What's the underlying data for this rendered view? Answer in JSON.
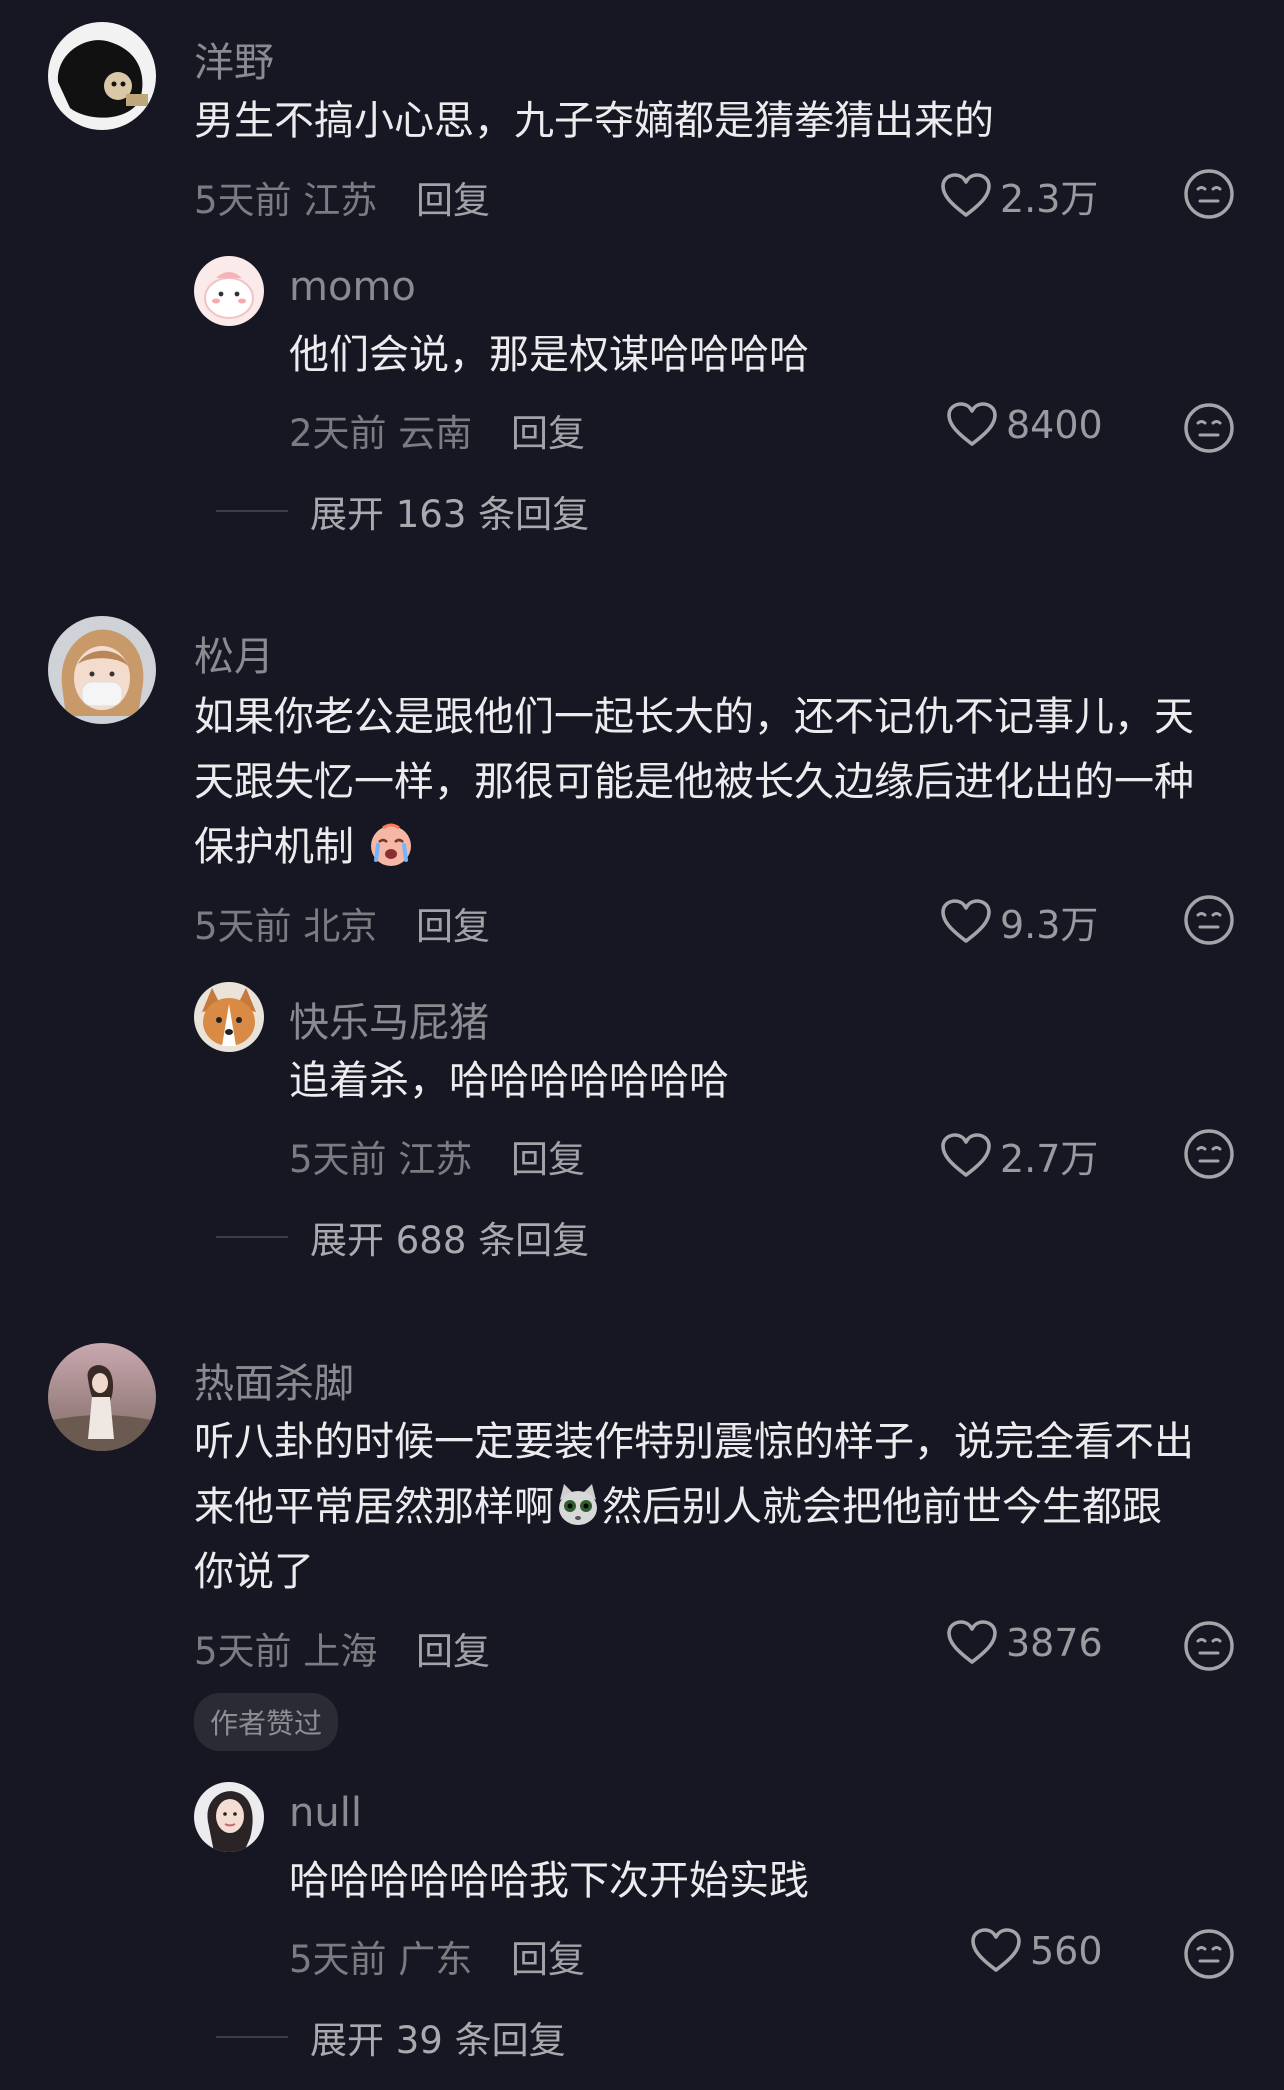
{
  "comments": [
    {
      "username": "洋野",
      "text": "男生不搞小心思，九子夺嫡都是猜拳猜出来的",
      "meta": "5天前 江苏",
      "reply_label": "回复",
      "likes": "2.3万",
      "reply": {
        "username": "momo",
        "text": "他们会说，那是权谋哈哈哈哈",
        "meta": "2天前 云南",
        "reply_label": "回复",
        "likes": "8400"
      },
      "expand_label": "展开 163 条回复"
    },
    {
      "username": "松月",
      "text_line1": "如果你老公是跟他们一起长大的，还不记仇不记事儿，天",
      "text_line2": "天跟失忆一样，那很可能是他被长久边缘后进化出的一种",
      "text_line3": "保护机制",
      "emoji_icon": "crying-face-emoji-icon",
      "meta": "5天前 北京",
      "reply_label": "回复",
      "likes": "9.3万",
      "reply": {
        "username": "快乐马屁猪",
        "text": "追着杀，哈哈哈哈哈哈哈",
        "meta": "5天前 江苏",
        "reply_label": "回复",
        "likes": "2.7万"
      },
      "expand_label": "展开 688 条回复"
    },
    {
      "username": "热面杀脚",
      "text_line1": "听八卦的时候一定要装作特别震惊的样子，说完全看不出",
      "text_line2a": "来他平常居然那样啊",
      "text_line2b": "然后别人就会把他前世今生都跟",
      "text_line3": "你说了",
      "emoji_icon": "shocked-cat-emoji-icon",
      "meta": "5天前 上海",
      "reply_label": "回复",
      "likes": "3876",
      "badge": "作者赞过",
      "reply": {
        "username": "null",
        "text": "哈哈哈哈哈哈我下次开始实践",
        "meta": "5天前 广东",
        "reply_label": "回复",
        "likes": "560"
      },
      "expand_label": "展开 39 条回复"
    }
  ],
  "colors": {
    "background": "#161722",
    "primary_text": "#ececee",
    "secondary_text": "#8a8b91"
  }
}
